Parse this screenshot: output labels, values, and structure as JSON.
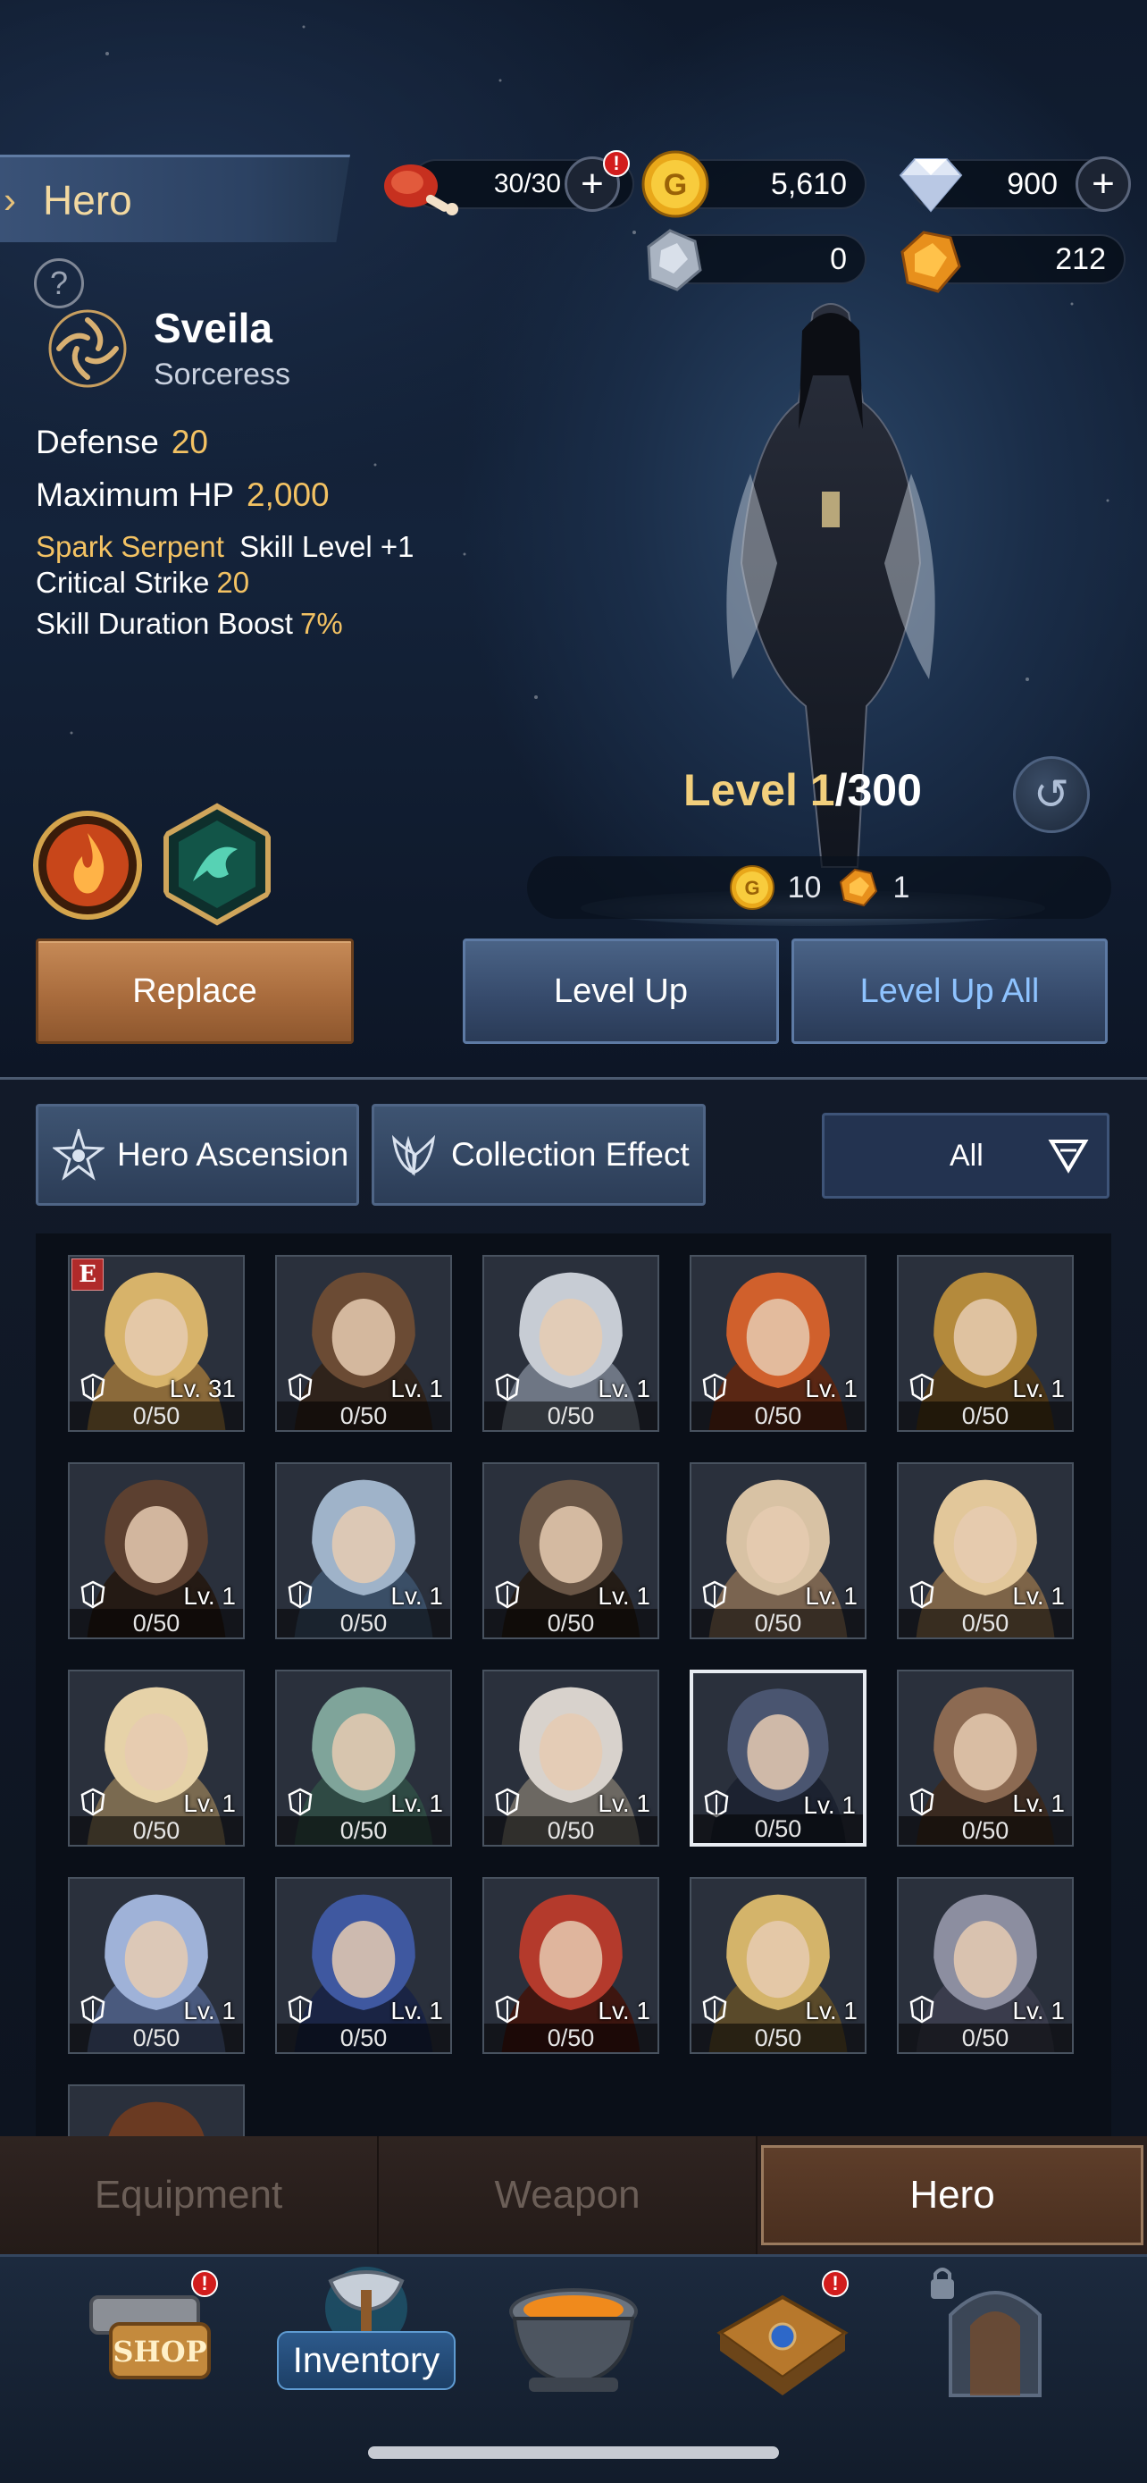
{
  "header": {
    "section_title": "Hero",
    "resources": {
      "stamina": "30/30",
      "gold": "5,610",
      "diamond": "900",
      "silver_stone": "0",
      "gold_stone": "212"
    },
    "help_symbol": "?"
  },
  "hero": {
    "name": "Sveila",
    "class": "Sorceress",
    "stats": [
      {
        "label": "Defense",
        "value": "20"
      },
      {
        "label": "Maximum HP",
        "value": "2,000"
      }
    ],
    "bonus_skill_name": "Spark Serpent",
    "bonus_skill_text": "Skill Level +1",
    "crit_label": "Critical Strike",
    "crit_value": "20",
    "duration_label": "Skill Duration Boost",
    "duration_value": "7%",
    "level_label": "Level",
    "level": "1",
    "level_max": "/300",
    "cost_gold": "10",
    "cost_stone": "1"
  },
  "buttons": {
    "replace": "Replace",
    "level_up": "Level Up",
    "level_up_all": "Level Up All",
    "hero_ascension": "Hero Ascension",
    "collection_effect": "Collection Effect",
    "filter_value": "All"
  },
  "cards": [
    {
      "lv": "Lv. 31",
      "count": "0/50",
      "rank": "E"
    },
    {
      "lv": "Lv. 1",
      "count": "0/50"
    },
    {
      "lv": "Lv. 1",
      "count": "0/50"
    },
    {
      "lv": "Lv. 1",
      "count": "0/50"
    },
    {
      "lv": "Lv. 1",
      "count": "0/50"
    },
    {
      "lv": "Lv. 1",
      "count": "0/50"
    },
    {
      "lv": "Lv. 1",
      "count": "0/50"
    },
    {
      "lv": "Lv. 1",
      "count": "0/50"
    },
    {
      "lv": "Lv. 1",
      "count": "0/50"
    },
    {
      "lv": "Lv. 1",
      "count": "0/50"
    },
    {
      "lv": "Lv. 1",
      "count": "0/50"
    },
    {
      "lv": "Lv. 1",
      "count": "0/50"
    },
    {
      "lv": "Lv. 1",
      "count": "0/50"
    },
    {
      "lv": "Lv. 1",
      "count": "0/50"
    },
    {
      "lv": "Lv. 1",
      "count": "0/50"
    },
    {
      "lv": "Lv. 1",
      "count": "0/50"
    },
    {
      "lv": "Lv. 1",
      "count": "0/50"
    },
    {
      "lv": "Lv. 1",
      "count": "0/50"
    },
    {
      "lv": "Lv. 1",
      "count": "0/50"
    },
    {
      "lv": "Lv. 1",
      "count": "0/50"
    }
  ],
  "tabs": [
    {
      "label": "Equipment"
    },
    {
      "label": "Weapon"
    },
    {
      "label": "Hero"
    }
  ],
  "nav": {
    "shop_text": "SHOP",
    "inventory_label": "Inventory"
  }
}
